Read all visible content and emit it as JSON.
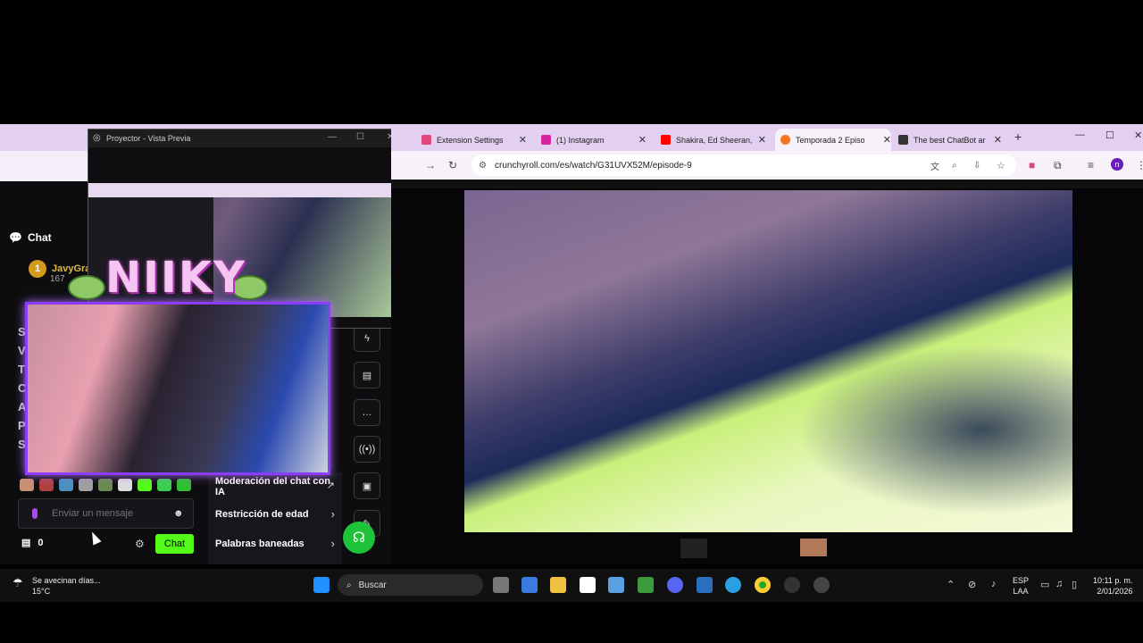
{
  "chat": {
    "header": "Chat",
    "user_name": "JavyGra",
    "user_badge": "1",
    "user_sub": "167",
    "letters": [
      "ST",
      "V",
      "TI",
      "CI",
      "AU",
      "PI",
      "SU"
    ],
    "input_placeholder": "Enviar un mensaje",
    "points": "0",
    "send_label": "Chat"
  },
  "settings": {
    "items": [
      "Moderación del chat con IA",
      "Restricción de edad",
      "Palabras baneadas"
    ]
  },
  "projector": {
    "title": "Proyector - Vista Previa"
  },
  "overlay": {
    "logo_text": "NIIKY"
  },
  "browser": {
    "tabs": [
      {
        "label": "Extension Settings",
        "color": "#e0457b"
      },
      {
        "label": "(1) Instagram",
        "color": "#d6249f"
      },
      {
        "label": "Shakira, Ed Sheeran,",
        "color": "#ff0000"
      },
      {
        "label": "Temporada 2 Episo",
        "color": "#f47521"
      },
      {
        "label": "The best ChatBot ar",
        "color": "#6441a5"
      }
    ],
    "url": "crunchyroll.com/es/watch/G31UVX52M/episode-9",
    "profile_initial": "n"
  },
  "taskbar": {
    "weather_text": "Se avecinan días...",
    "temperature": "15°C",
    "search_label": "Buscar",
    "lang_top": "ESP",
    "lang_bottom": "LAA",
    "time": "10:11 p. m.",
    "date": "2/01/2026"
  }
}
